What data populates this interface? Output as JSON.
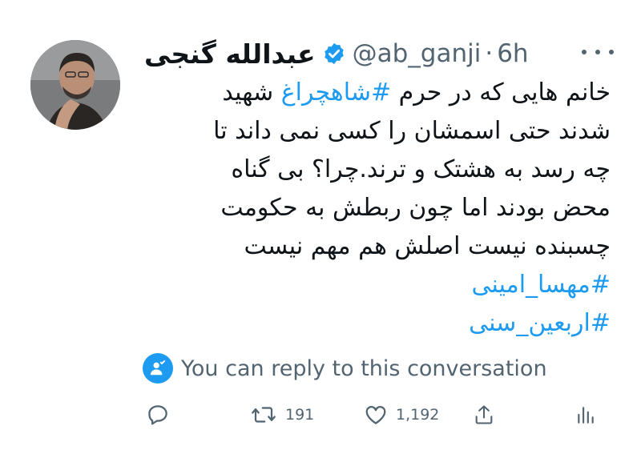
{
  "author": {
    "display_name": "عبدالله گنجی",
    "handle": "@ab_ganji",
    "separator": "·",
    "timestamp": "6h",
    "verified": true
  },
  "tweet": {
    "lines": [
      {
        "before": "خانم هایی که در حرم ",
        "tag": "#شاهچراغ",
        "after": " شهید"
      },
      {
        "text": "شدند حتی اسمشان را کسی نمی داند تا"
      },
      {
        "text": "چه رسد به هشتک و ترند.چرا؟ بی گناه"
      },
      {
        "text": "محض بودند اما چون ربطش به حکومت"
      },
      {
        "text": "چسبنده نیست اصلش هم مهم نیست"
      }
    ],
    "hashtags": [
      "#مهسا_امینی",
      "#اربعین_سنی"
    ]
  },
  "reply_notice": "You can reply to this conversation",
  "actions": {
    "retweets": "191",
    "likes": "1,192"
  },
  "colors": {
    "accent": "#1d9bf0",
    "text": "#0f1419",
    "muted": "#536471"
  },
  "icons": [
    "verified-badge-icon",
    "more-options-icon",
    "mention-person-icon",
    "reply-icon",
    "retweet-icon",
    "like-icon",
    "share-icon",
    "analytics-icon"
  ]
}
